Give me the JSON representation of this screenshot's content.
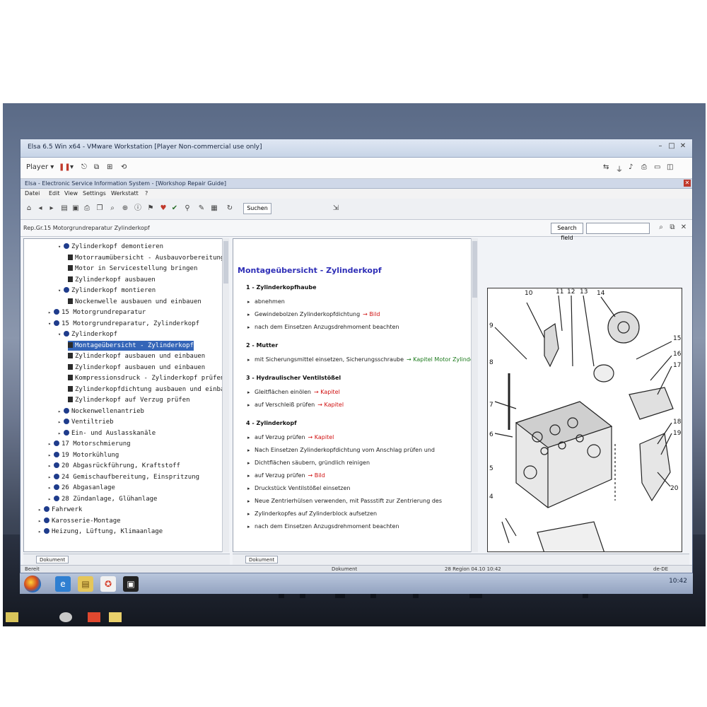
{
  "window": {
    "title": "Elsa 6.5 Win x64 - VMware Workstation [Player Non-commercial use only]"
  },
  "vmware_toolbar": {
    "player_label": "Player"
  },
  "app": {
    "title": "Elsa - Electronic Service Information System - [Workshop Repair Guide]",
    "menu": [
      "Datei",
      "Edit",
      "View",
      "Settings",
      "Werkstatt",
      "?"
    ],
    "search_button": "Suchen",
    "breadcrumb": "Rep.Gr.15 Motorgrundreparatur Zylinderkopf",
    "search_label": "Search field"
  },
  "tree": {
    "nodes": [
      {
        "text": "Zylinderkopf demontieren",
        "indent": 3,
        "marker": "bullet",
        "twisty": "open"
      },
      {
        "text": "Motorraumübersicht - Ausbauvorbereitung",
        "indent": 4,
        "marker": "square"
      },
      {
        "text": "Motor in Servicestellung bringen",
        "indent": 4,
        "marker": "square"
      },
      {
        "text": "Zylinderkopf ausbauen",
        "indent": 4,
        "marker": "square"
      },
      {
        "text": "Zylinderkopf montieren",
        "indent": 3,
        "marker": "bullet",
        "twisty": "open"
      },
      {
        "text": "Nockenwelle ausbauen und einbauen",
        "indent": 4,
        "marker": "square"
      },
      {
        "text": "15 Motorgrundreparatur",
        "indent": 2,
        "marker": "bullet",
        "twisty": "closed"
      },
      {
        "text": "15 Motorgrundreparatur, Zylinderkopf",
        "indent": 2,
        "marker": "bullet",
        "twisty": "open"
      },
      {
        "text": "Zylinderkopf",
        "indent": 3,
        "marker": "bullet",
        "twisty": "open"
      },
      {
        "text": "Montageübersicht - Zylinderkopf",
        "indent": 4,
        "marker": "square",
        "selected": true
      },
      {
        "text": "Zylinderkopf ausbauen und einbauen",
        "indent": 4,
        "marker": "square"
      },
      {
        "text": "Zylinderkopf ausbauen und einbauen",
        "indent": 4,
        "marker": "square"
      },
      {
        "text": "Kompressionsdruck - Zylinderkopf prüfen",
        "indent": 4,
        "marker": "square"
      },
      {
        "text": "Zylinderkopfdichtung ausbauen und einbauen",
        "indent": 4,
        "marker": "square"
      },
      {
        "text": "Zylinderkopf auf Verzug prüfen",
        "indent": 4,
        "marker": "square"
      },
      {
        "text": "Nockenwellenantrieb",
        "indent": 3,
        "marker": "bullet",
        "twisty": "closed"
      },
      {
        "text": "Ventiltrieb",
        "indent": 3,
        "marker": "bullet",
        "twisty": "closed"
      },
      {
        "text": "Ein- und Auslasskanäle",
        "indent": 3,
        "marker": "bullet",
        "twisty": "closed"
      },
      {
        "text": "17 Motorschmierung",
        "indent": 2,
        "marker": "bullet",
        "twisty": "closed"
      },
      {
        "text": "19 Motorkühlung",
        "indent": 2,
        "marker": "bullet",
        "twisty": "closed"
      },
      {
        "text": "20 Abgasrückführung, Kraftstoff",
        "indent": 2,
        "marker": "bullet",
        "twisty": "closed"
      },
      {
        "text": "24 Gemischaufbereitung, Einspritzung",
        "indent": 2,
        "marker": "bullet",
        "twisty": "closed"
      },
      {
        "text": "26 Abgasanlage",
        "indent": 2,
        "marker": "bullet",
        "twisty": "closed"
      },
      {
        "text": "28 Zündanlage, Glühanlage",
        "indent": 2,
        "marker": "bullet",
        "twisty": "closed"
      },
      {
        "text": "Fahrwerk",
        "indent": 1,
        "marker": "bullet",
        "twisty": "closed"
      },
      {
        "text": "Karosserie-Montage",
        "indent": 1,
        "marker": "bullet",
        "twisty": "closed"
      },
      {
        "text": "Heizung, Lüftung, Klimaanlage",
        "indent": 1,
        "marker": "bullet",
        "twisty": "closed"
      }
    ],
    "tab_label": "Dokument"
  },
  "document": {
    "heading": "Montageübersicht - Zylinderkopf",
    "sections": [
      {
        "title": "1 - Zylinderkopfhaube",
        "steps": [
          {
            "text": "abnehmen",
            "red": "",
            "green": ""
          },
          {
            "text": "Gewindebolzen Zylinderkopfdichtung",
            "red": "→ Bild",
            "green": ""
          },
          {
            "text": "nach dem Einsetzen Anzugsdrehmoment beachten",
            "red": "",
            "green": ""
          }
        ]
      },
      {
        "title": "2 - Mutter",
        "steps": [
          {
            "text": "mit Sicherungsmittel einsetzen, Sicherungsschraube",
            "red": "",
            "green": "→ Kapitel Motor Zylinderkopf"
          }
        ]
      },
      {
        "title": "3 - Hydraulischer Ventilstößel",
        "steps": [
          {
            "text": "Gleitflächen einölen",
            "red": "→ Kapitel",
            "green": ""
          },
          {
            "text": "auf Verschleiß prüfen",
            "red": "→ Kapitel",
            "green": ""
          }
        ]
      },
      {
        "title": "4 - Zylinderkopf",
        "steps": [
          {
            "text": "auf Verzug prüfen",
            "red": "→ Kapitel",
            "green": ""
          },
          {
            "text": "Nach Einsetzen Zylinderkopfdichtung vom Anschlag prüfen und",
            "red": "",
            "green": ""
          },
          {
            "text": "Dichtflächen säubern, gründlich reinigen",
            "red": "",
            "green": ""
          },
          {
            "text": "auf Verzug prüfen",
            "red": "→ Bild",
            "green": ""
          },
          {
            "text": "Druckstück Ventilstößel einsetzen",
            "red": "",
            "green": ""
          },
          {
            "text": "Neue Zentrierhülsen verwenden, mit Passstift zur Zentrierung des",
            "red": "",
            "green": ""
          },
          {
            "text": "Zylinderkopfes auf Zylinderblock aufsetzen",
            "red": "",
            "green": ""
          },
          {
            "text": "nach dem Einsetzen Anzugsdrehmoment beachten",
            "red": "",
            "green": ""
          }
        ]
      }
    ],
    "tab_label": "Dokument",
    "figure_labels": [
      "10",
      "11",
      "12",
      "13",
      "14",
      "9",
      "8",
      "7",
      "6",
      "5",
      "4",
      "15",
      "16",
      "17",
      "18",
      "19",
      "20"
    ]
  },
  "statusbar": {
    "left": "Bereit",
    "center": "Dokument",
    "right_info": "28 Region 04.10 10:42",
    "far_right": "de-DE"
  },
  "taskbar": {
    "clock": "10:42"
  },
  "colors": {
    "heading": "#2f2fb7",
    "selection": "#3465b8",
    "link_red": "#d01010",
    "link_green": "#1c7a1c"
  }
}
